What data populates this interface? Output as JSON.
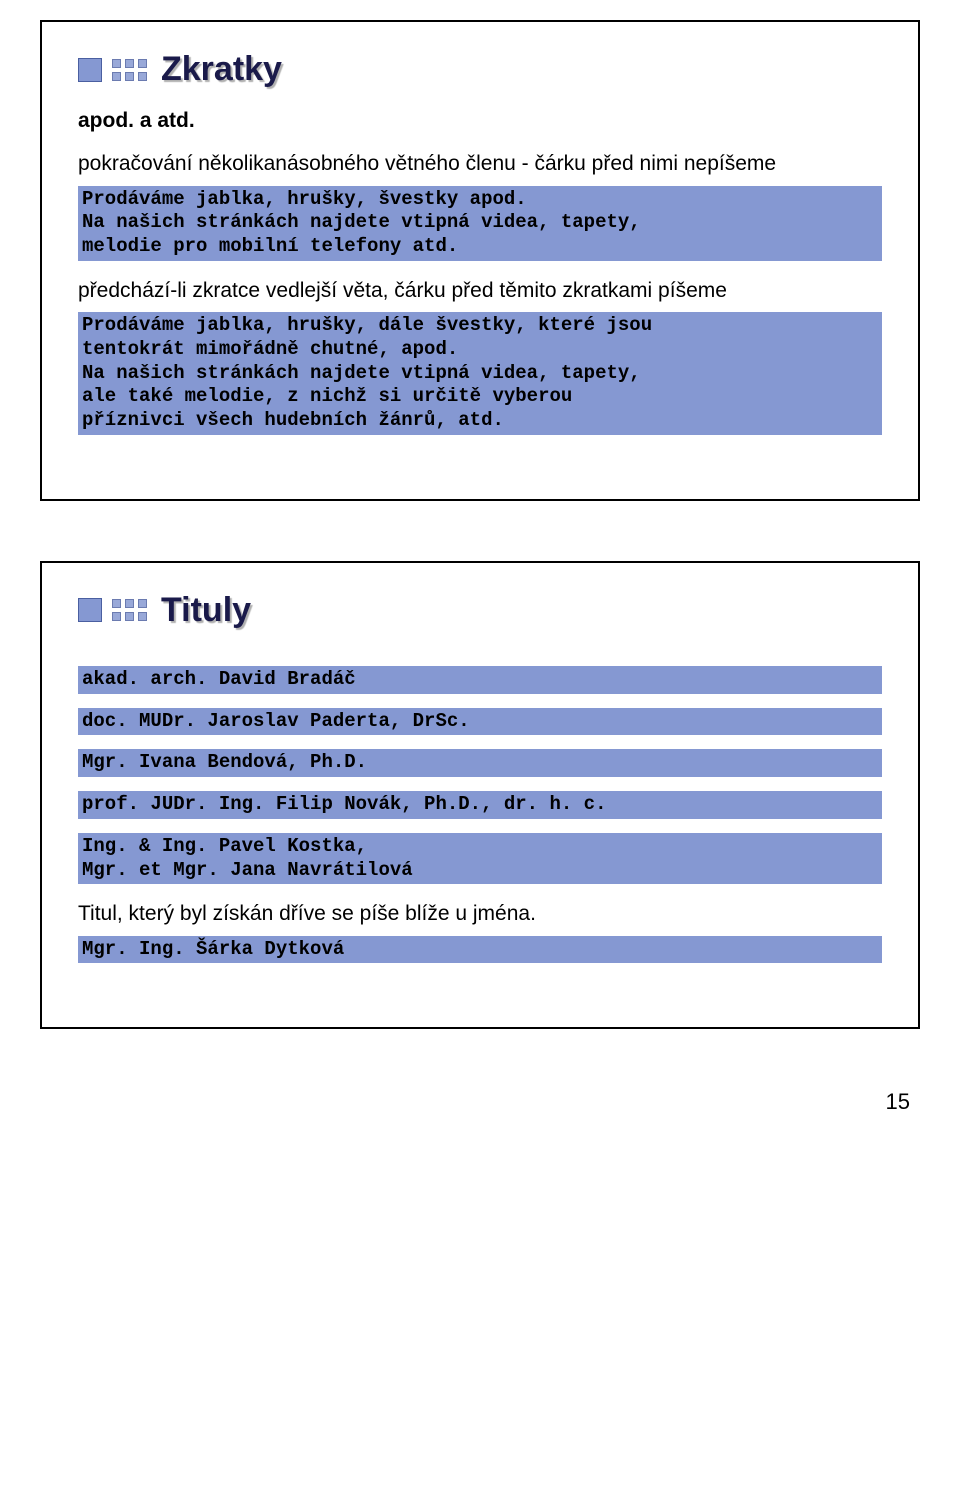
{
  "slide1": {
    "title": "Zkratky",
    "sub1": "apod. a atd.",
    "text1": "pokračování několikanásobného větného členu - čárku před nimi nepíšeme",
    "code1": "Prodáváme jablka, hrušky, švestky apod.\nNa našich stránkách najdete vtipná videa, tapety, \nmelodie pro mobilní telefony atd.",
    "text2": "předchází-li zkratce vedlejší věta, čárku před těmito zkratkami píšeme",
    "code2": "Prodáváme jablka, hrušky, dále švestky, které jsou \ntentokrát mimořádně chutné, apod.\nNa našich stránkách najdete vtipná videa, tapety, \nale také melodie, z nichž si určitě vyberou \npříznivci všech hudebních žánrů, atd."
  },
  "slide2": {
    "title": "Tituly",
    "code1": "akad. arch. David Bradáč",
    "code2": "doc. MUDr. Jaroslav Paderta, DrSc.",
    "code3": "Mgr. Ivana Bendová, Ph.D.",
    "code4": "prof. JUDr. Ing. Filip Novák, Ph.D., dr. h. c.",
    "code5": "Ing. & Ing. Pavel Kostka,\nMgr. et Mgr. Jana Navrátilová",
    "text1": "Titul, který byl získán dříve se píše blíže u jména.",
    "code6": "Mgr. Ing. Šárka Dytková"
  },
  "pageNumber": "15"
}
